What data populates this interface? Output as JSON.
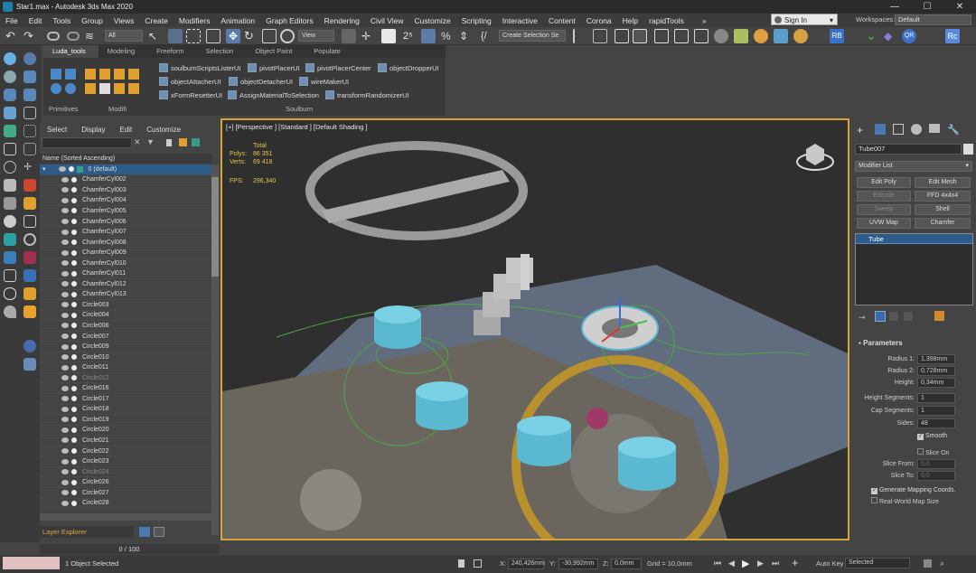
{
  "window": {
    "title": "Star1.max - Autodesk 3ds Max 2020",
    "minimize": "—",
    "maximize": "☐",
    "close": "✕"
  },
  "menu": [
    "File",
    "Edit",
    "Tools",
    "Group",
    "Views",
    "Create",
    "Modifiers",
    "Animation",
    "Graph Editors",
    "Rendering",
    "Civil View",
    "Customize",
    "Scripting",
    "Interactive",
    "Content",
    "Corona",
    "Help",
    "rapidTools"
  ],
  "menu_overflow": "»",
  "signin": "Sign In",
  "workspaces": {
    "label": "Workspaces:",
    "value": "Default"
  },
  "toolbar": {
    "filter_select": "All",
    "view_select": "View",
    "selection_set": "Create Selection Se"
  },
  "ribbon": {
    "tabs": [
      "Luda_tools",
      "Modeling",
      "Freeform",
      "Selection",
      "Object Paint",
      "Populate"
    ],
    "soulburn_buttons": [
      "soulburnScriptsListerUI",
      "pivotPlacerUI",
      "pivotPlacerCenter",
      "objectDropperUI",
      "objectAttacherUI",
      "objectDetacherUI",
      "wireMakerUI",
      "xFormResetterUI",
      "AssignMaterialToSelection",
      "transformRandomizerUI"
    ],
    "groups": [
      "Primitives",
      "Modifi",
      "Soulburn"
    ]
  },
  "explorer": {
    "menu": [
      "Select",
      "Display",
      "Edit",
      "Customize"
    ],
    "column_header": "Name (Sorted Ascending)",
    "default_layer": "0 (default)",
    "objects": [
      "ChamferCyl002",
      "ChamferCyl003",
      "ChamferCyl004",
      "ChamferCyl005",
      "ChamferCyl006",
      "ChamferCyl007",
      "ChamferCyl008",
      "ChamferCyl009",
      "ChamferCyl010",
      "ChamferCyl011",
      "ChamferCyl012",
      "ChamferCyl013",
      "Circle003",
      "Circle004",
      "Circle006",
      "Circle007",
      "Circle009",
      "Circle010",
      "Circle011",
      "Circle012",
      "Circle016",
      "Circle017",
      "Circle018",
      "Circle019",
      "Circle020",
      "Circle021",
      "Circle022",
      "Circle023",
      "Circle024",
      "Circle026",
      "Circle027",
      "Circle028"
    ],
    "dim_objects": [
      "Circle012",
      "Circle024"
    ],
    "layer_explorer": "Layer Explorer"
  },
  "frame_counter": "0 / 100",
  "viewport": {
    "label": "[+] [Perspective ] [Standard ] [Default Shading ]",
    "stats": {
      "total_label": "Total",
      "polys_label": "Polys:",
      "polys": "86 351",
      "verts_label": "Verts:",
      "verts": "69 418",
      "fps_label": "FPS:",
      "fps": "296,340"
    }
  },
  "command_panel": {
    "object_name": "Tube007",
    "modifier_list": "Modifier List",
    "buttons": [
      "Edit Poly",
      "Edit Mesh",
      "Extrude",
      "FFD 4x4x4",
      "Sweep",
      "Shell",
      "UVW Map",
      "Chamfer"
    ],
    "disabled_buttons": [
      "Extrude",
      "Sweep"
    ],
    "stack_item": "Tube",
    "rollout": "Parameters",
    "params": [
      {
        "label": "Radius 1:",
        "value": "1,398mm"
      },
      {
        "label": "Radius 2:",
        "value": "0,728mm"
      },
      {
        "label": "Height:",
        "value": "0,34mm"
      },
      {
        "label": "Height Segments:",
        "value": "1"
      },
      {
        "label": "Cap Segments:",
        "value": "1"
      },
      {
        "label": "Sides:",
        "value": "48"
      }
    ],
    "smooth": "Smooth",
    "slice_on": "Slice On",
    "slice_from": {
      "label": "Slice From:",
      "value": "0,0"
    },
    "slice_to": {
      "label": "Slice To:",
      "value": "0,0"
    },
    "gen_mapping": "Generate Mapping Coords.",
    "real_world": "Real-World Map Size"
  },
  "status": {
    "text": "1 Object Selected",
    "x_label": "X:",
    "x": "240,426mm",
    "y_label": "Y:",
    "y": "-30,992mm",
    "z_label": "Z:",
    "z": "0,0mm",
    "grid": "Grid = 10,0mm",
    "auto_key": "Auto Key",
    "selected": "Selected"
  },
  "colors": {
    "accent_blue": "#5ab8d0",
    "viewport_border": "#d6a53a",
    "stats_yellow": "#e3c74a",
    "selection_blue": "#2d5c8a"
  }
}
